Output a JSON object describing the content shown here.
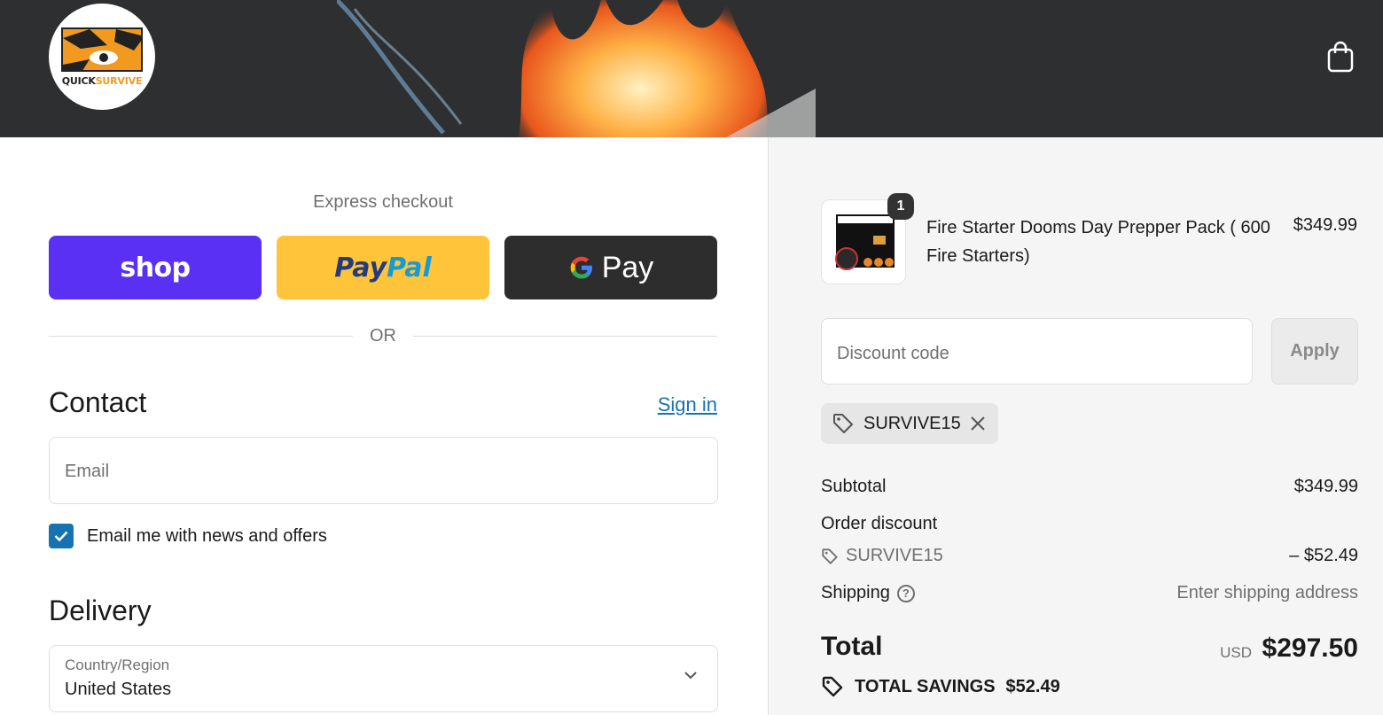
{
  "header": {
    "logo_text_a": "QUICK",
    "logo_text_b": "SURVIVE",
    "cart_icon": "shopping-bag-icon"
  },
  "express": {
    "title": "Express checkout",
    "shop_label": "shop",
    "paypal_a": "Pay",
    "paypal_b": "Pal",
    "gpay_g": "G",
    "gpay_label": "Pay",
    "or_label": "OR"
  },
  "contact": {
    "title": "Contact",
    "signin": "Sign in",
    "email_placeholder": "Email",
    "newsletter_label": "Email me with news and offers",
    "newsletter_checked": true
  },
  "delivery": {
    "title": "Delivery",
    "country_label": "Country/Region",
    "country_value": "United States"
  },
  "summary": {
    "product": {
      "name": "Fire Starter Dooms Day Prepper Pack ( 600 Fire Starters)",
      "price": "$349.99",
      "quantity": "1"
    },
    "discount_placeholder": "Discount code",
    "apply_label": "Apply",
    "applied_code": "SURVIVE15",
    "subtotal_label": "Subtotal",
    "subtotal_value": "$349.99",
    "order_discount_label": "Order discount",
    "order_discount_code": "SURVIVE15",
    "order_discount_value": "– $52.49",
    "shipping_label": "Shipping",
    "shipping_value": "Enter shipping address",
    "total_label": "Total",
    "total_currency": "USD",
    "total_value": "$297.50",
    "savings_label": "TOTAL SAVINGS",
    "savings_value": "$52.49"
  },
  "colors": {
    "header_bg": "#2e2f31",
    "shop_purple": "#5a31f4",
    "paypal_yellow": "#ffc439",
    "gpay_dark": "#2d2d2d",
    "link_blue": "#1773b0",
    "summary_bg": "#f5f5f5"
  }
}
